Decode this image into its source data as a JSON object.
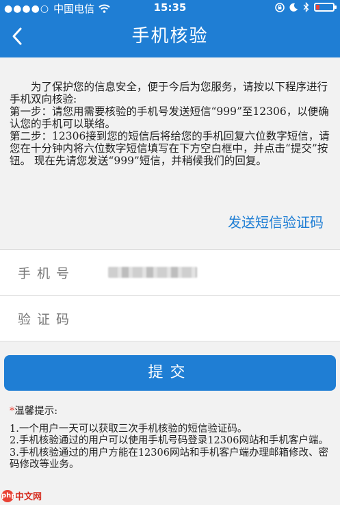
{
  "status_bar": {
    "signal": "●●●●○",
    "carrier": "中国电信",
    "time": "15:35",
    "battery_level": 0.2,
    "battery_color": "#e94235"
  },
  "nav": {
    "title": "手机核验",
    "back_icon": "chevron-left-icon",
    "color": "#1f7ed4"
  },
  "notice": {
    "intro": "为了保护您的信息安全，便于今后为您服务，请按以下程序进行手机双向核验:",
    "step1": "第一步：请您用需要核验的手机号发送短信“999”至12306，以便确认您的手机可以联络。",
    "step2": "第二步：12306接到您的短信后将给您的手机回复六位数字短信，请您在十分钟内将六位数字短信填写在下方空白框中，并点击“提交”按钮。 现在先请您发送“999”短信，并稍候我们的回复。"
  },
  "send_code_link": "发送短信验证码",
  "form": {
    "phone_label": "手机号",
    "code_label": "验证码",
    "code_value": ""
  },
  "submit_label": "提交",
  "tips": {
    "marker": "*",
    "title": "温馨提示:",
    "items": [
      "1.一个用户一天可以获取三次手机核验的短信验证码。",
      "2.手机核验通过的用户可以使用手机号码登录12306网站和手机客户端。",
      "3.手机核验通过的用户方能在12306网站和手机客户端办理邮箱修改、密码修改等业务。"
    ]
  },
  "watermark": {
    "logo": "php",
    "text": "中文网"
  }
}
